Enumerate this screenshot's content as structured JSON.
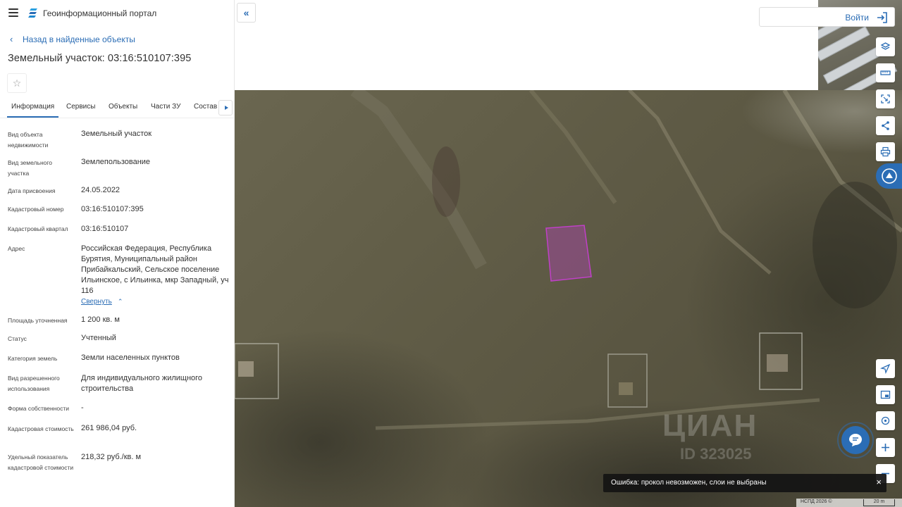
{
  "header": {
    "app_title": "Геоинформационный портал"
  },
  "nav": {
    "back_label": "Назад в найденные объекты"
  },
  "object": {
    "title": "Земельный участок: 03:16:510107:395"
  },
  "tabs": [
    {
      "label": "Информация"
    },
    {
      "label": "Сервисы"
    },
    {
      "label": "Объекты"
    },
    {
      "label": "Части ЗУ"
    },
    {
      "label": "Состав"
    }
  ],
  "properties": [
    {
      "label": "Вид объекта недвижимости",
      "value": "Земельный участок"
    },
    {
      "label": "Вид земельного участка",
      "value": "Землепользование"
    },
    {
      "label": "Дата присвоения",
      "value": "24.05.2022"
    },
    {
      "label": "Кадастровый номер",
      "value": "03:16:510107:395"
    },
    {
      "label": "Кадастровый квартал",
      "value": "03:16:510107"
    },
    {
      "label": "Адрес",
      "value": "Российская Федерация, Республика Бурятия, Муниципальный район Прибайкальский, Сельское поселение Ильинское, с Ильинка, мкр Западный, уч 116"
    },
    {
      "label": "Площадь уточненная",
      "value": "1 200 кв. м"
    },
    {
      "label": "Статус",
      "value": "Учтенный"
    },
    {
      "label": "Категория земель",
      "value": "Земли населенных пунктов"
    },
    {
      "label": "Вид разрешенного использования",
      "value": "Для индивидуального жилищного строительства"
    },
    {
      "label": "Форма собственности",
      "value": "-"
    },
    {
      "label": "Кадастровая стоимость",
      "value": "261 986,04 руб."
    },
    {
      "label": "Удельный показатель кадастровой стоимости",
      "value": "218,32 руб./кв. м"
    }
  ],
  "address_toggle": {
    "label": "Свернуть"
  },
  "login": {
    "label": "Войти"
  },
  "toast": {
    "message": "Ошибка: прокол невозможен, слои не выбраны",
    "close": "×"
  },
  "map": {
    "copyright": "НСПД 2026 ©",
    "scale": "20 m",
    "watermark": "ЦИАН",
    "watermark_id": "ID 323025"
  },
  "colors": {
    "accent": "#2b6db5",
    "parcel": "#c040c8"
  }
}
